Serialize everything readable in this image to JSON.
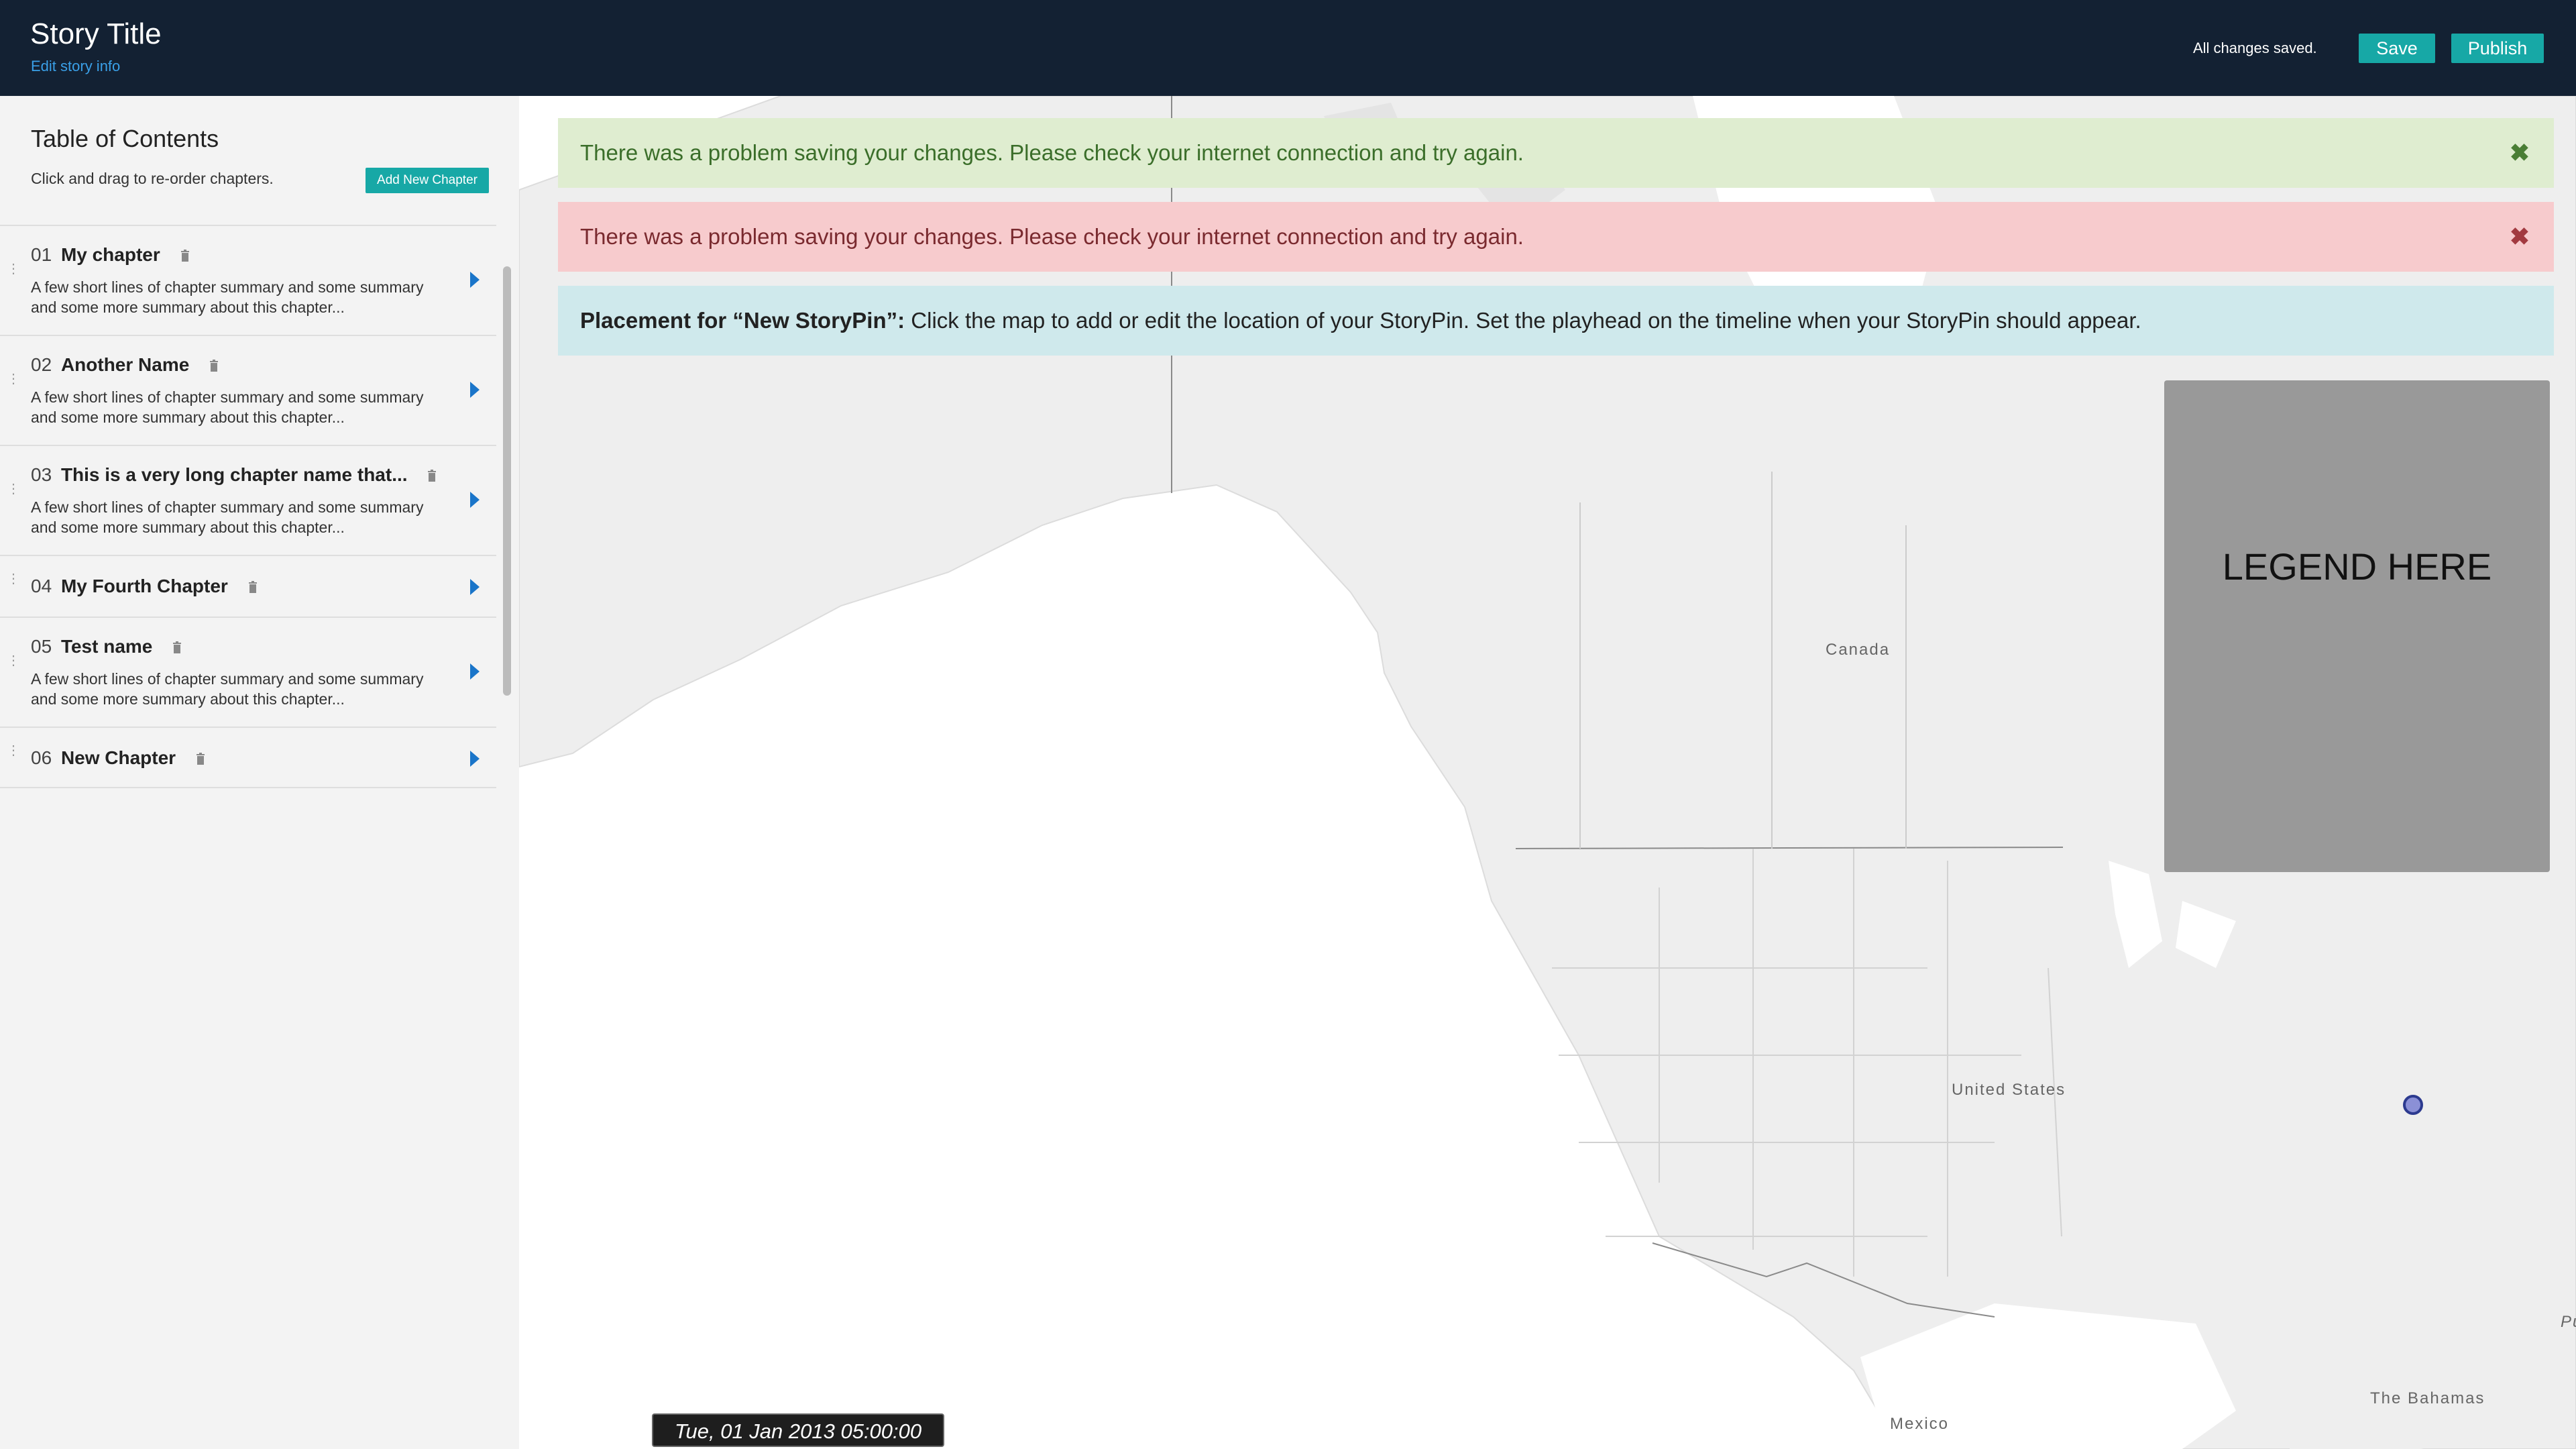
{
  "header": {
    "title": "Story Title",
    "edit_link": "Edit story info",
    "status": "All changes saved.",
    "save_label": "Save",
    "publish_label": "Publish"
  },
  "sidebar": {
    "title": "Table of Contents",
    "instructions": "Click and drag to re-order chapters.",
    "add_button": "Add New Chapter",
    "chapters": [
      {
        "num": "01",
        "name": "My chapter",
        "summary": "A few short lines of chapter summary and some summary and some more summary about this chapter..."
      },
      {
        "num": "02",
        "name": "Another Name",
        "summary": "A few short lines of chapter summary and some summary and some more summary about this chapter..."
      },
      {
        "num": "03",
        "name": "This is a very long chapter name that...",
        "summary": "A few short lines of chapter summary and some summary and some more summary about this chapter..."
      },
      {
        "num": "04",
        "name": "My Fourth Chapter",
        "summary": ""
      },
      {
        "num": "05",
        "name": "Test name",
        "summary": "A few short lines of chapter summary and some summary and some more summary about this chapter..."
      },
      {
        "num": "06",
        "name": "New Chapter",
        "summary": ""
      }
    ]
  },
  "alerts": {
    "success": "There was a problem saving your changes. Please check your internet connection and try again.",
    "danger": "There was a problem saving your changes. Please check your internet connection and try again.",
    "info_bold": "Placement for “New StoryPin”:",
    "info_text": " Click the map to add or edit the location of your StoryPin. Set the playhead on the timeline when your StoryPin should appear."
  },
  "map": {
    "labels": {
      "canada": "Canada",
      "us": "United States",
      "mexico": "Mexico",
      "bahamas": "The Bahamas",
      "edge": "Pu"
    },
    "legend": "LEGEND HERE",
    "timestamp": "Tue, 01 Jan 2013 05:00:00 GMT"
  },
  "colors": {
    "header_bg": "#132133",
    "accent": "#17a8a6",
    "link": "#3aa0e8",
    "success_bg": "#dfedd0",
    "danger_bg": "#f7cbcd",
    "info_bg": "#cfe9ec",
    "land": "#eeeeee"
  }
}
